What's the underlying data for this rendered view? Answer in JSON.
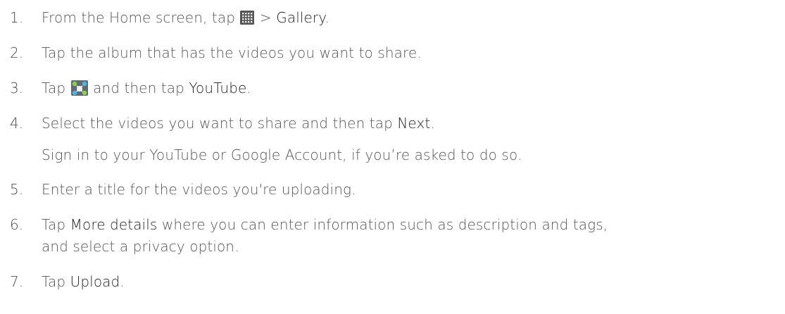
{
  "steps": [
    {
      "number": "1.",
      "parts": [
        {
          "t": "From the Home screen, tap "
        },
        {
          "icon": "apps-grid-icon"
        },
        {
          "t": " > "
        },
        {
          "t": "Gallery",
          "kw": true
        },
        {
          "t": "."
        }
      ]
    },
    {
      "number": "2.",
      "parts": [
        {
          "t": "Tap the album that has the videos you want to share."
        }
      ]
    },
    {
      "number": "3.",
      "parts": [
        {
          "t": "Tap "
        },
        {
          "icon": "share-icon"
        },
        {
          "t": " and then tap "
        },
        {
          "t": "YouTube",
          "kw": true
        },
        {
          "t": "."
        }
      ]
    },
    {
      "number": "4.",
      "parts": [
        {
          "t": "Select the videos you want to share and then tap "
        },
        {
          "t": "Next",
          "kw": true
        },
        {
          "t": "."
        }
      ]
    },
    {
      "number": "",
      "parts": [
        {
          "t": "Sign in to your YouTube or Google Account, if you’re asked to do so."
        }
      ]
    },
    {
      "number": "5.",
      "parts": [
        {
          "t": "Enter a title for the videos you're uploading."
        }
      ]
    },
    {
      "number": "6.",
      "parts": [
        {
          "t": "Tap "
        },
        {
          "t": "More details",
          "kw": true
        },
        {
          "t": " where you can enter information such as description and tags,"
        }
      ]
    },
    {
      "number": "",
      "parts": [
        {
          "t": "and select a privacy option."
        }
      ]
    },
    {
      "number": "7.",
      "parts": [
        {
          "t": "Tap "
        },
        {
          "t": "Upload",
          "kw": true
        },
        {
          "t": "."
        }
      ]
    }
  ]
}
